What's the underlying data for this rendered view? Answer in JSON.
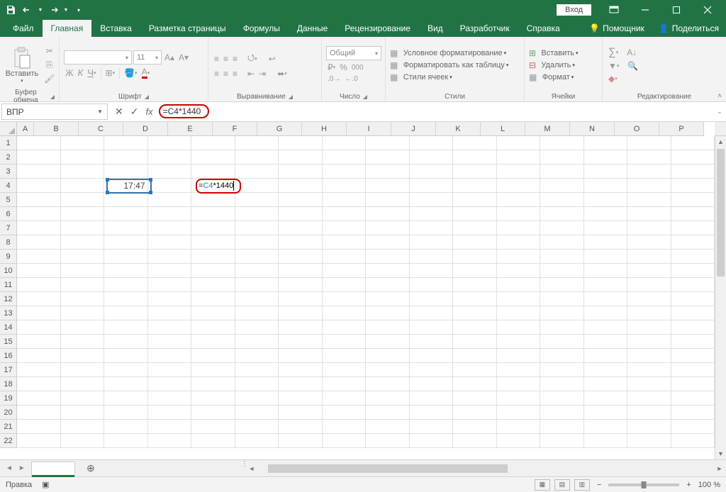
{
  "titlebar": {
    "login": "Вход"
  },
  "tabs": {
    "file": "Файл",
    "home": "Главная",
    "insert": "Вставка",
    "pagelayout": "Разметка страницы",
    "formulas": "Формулы",
    "data": "Данные",
    "review": "Рецензирование",
    "view": "Вид",
    "developer": "Разработчик",
    "help": "Справка",
    "tellme": "Помощник",
    "share": "Поделиться"
  },
  "ribbon": {
    "paste": "Вставить",
    "clipboard": "Буфер обмена",
    "font": "Шрифт",
    "font_size": "11",
    "font_group": "Шрифт",
    "alignment": "Выравнивание",
    "number_format": "Общий",
    "number": "Число",
    "cond_fmt": "Условное форматирование",
    "fmt_table": "Форматировать как таблицу",
    "cell_styles": "Стили ячеек",
    "styles": "Стили",
    "insert_btn": "Вставить",
    "delete_btn": "Удалить",
    "format_btn": "Формат",
    "cells": "Ячейки",
    "editing": "Редактирование"
  },
  "formula_bar": {
    "name_box": "ВПР",
    "formula": "=C4*1440"
  },
  "columns": [
    "A",
    "B",
    "C",
    "D",
    "E",
    "F",
    "G",
    "H",
    "I",
    "J",
    "K",
    "L",
    "M",
    "N",
    "O",
    "P"
  ],
  "rows": [
    1,
    2,
    3,
    4,
    5,
    6,
    7,
    8,
    9,
    10,
    11,
    12,
    13,
    14,
    15,
    16,
    17,
    18,
    19,
    20,
    21,
    22
  ],
  "cells": {
    "C4": "17:47",
    "E4_prefix": "=",
    "E4_ref": "C4",
    "E4_suffix": "*1440"
  },
  "sheet": {
    "name": " "
  },
  "status": {
    "mode": "Правка",
    "zoom": "100 %"
  }
}
